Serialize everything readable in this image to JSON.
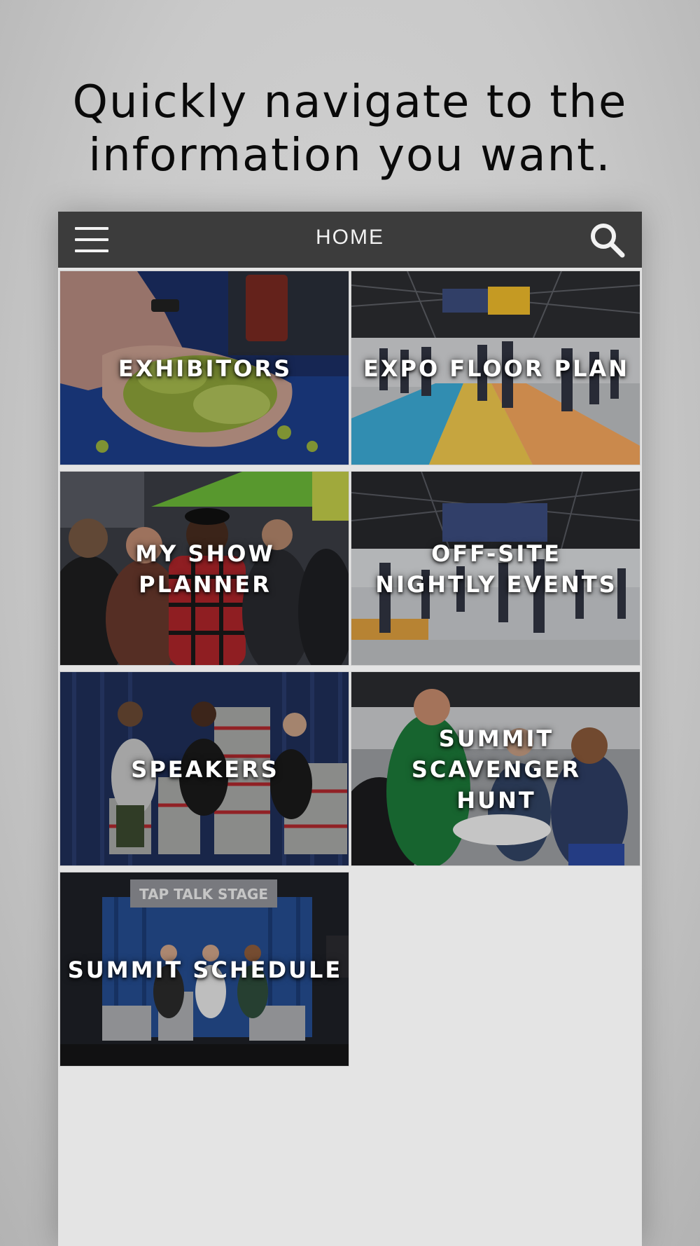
{
  "headline": {
    "line1": "Quickly navigate to the",
    "line2": "information you want."
  },
  "nav": {
    "title": "HOME",
    "menu_icon": "hamburger-menu-icon",
    "search_icon": "search-icon",
    "background": "#3c3c3c"
  },
  "tiles": [
    {
      "label": "EXHIBITORS"
    },
    {
      "label": "EXPO FLOOR PLAN"
    },
    {
      "label": "MY SHOW PLANNER"
    },
    {
      "label": "OFF-SITE\nNIGHTLY EVENTS"
    },
    {
      "label": "SPEAKERS"
    },
    {
      "label": "SUMMIT SCAVENGER\nHUNT"
    },
    {
      "label": "SUMMIT SCHEDULE"
    }
  ],
  "photos": {
    "exhibitors_sign": "",
    "schedule_sign": "TAP TALK STAGE"
  }
}
